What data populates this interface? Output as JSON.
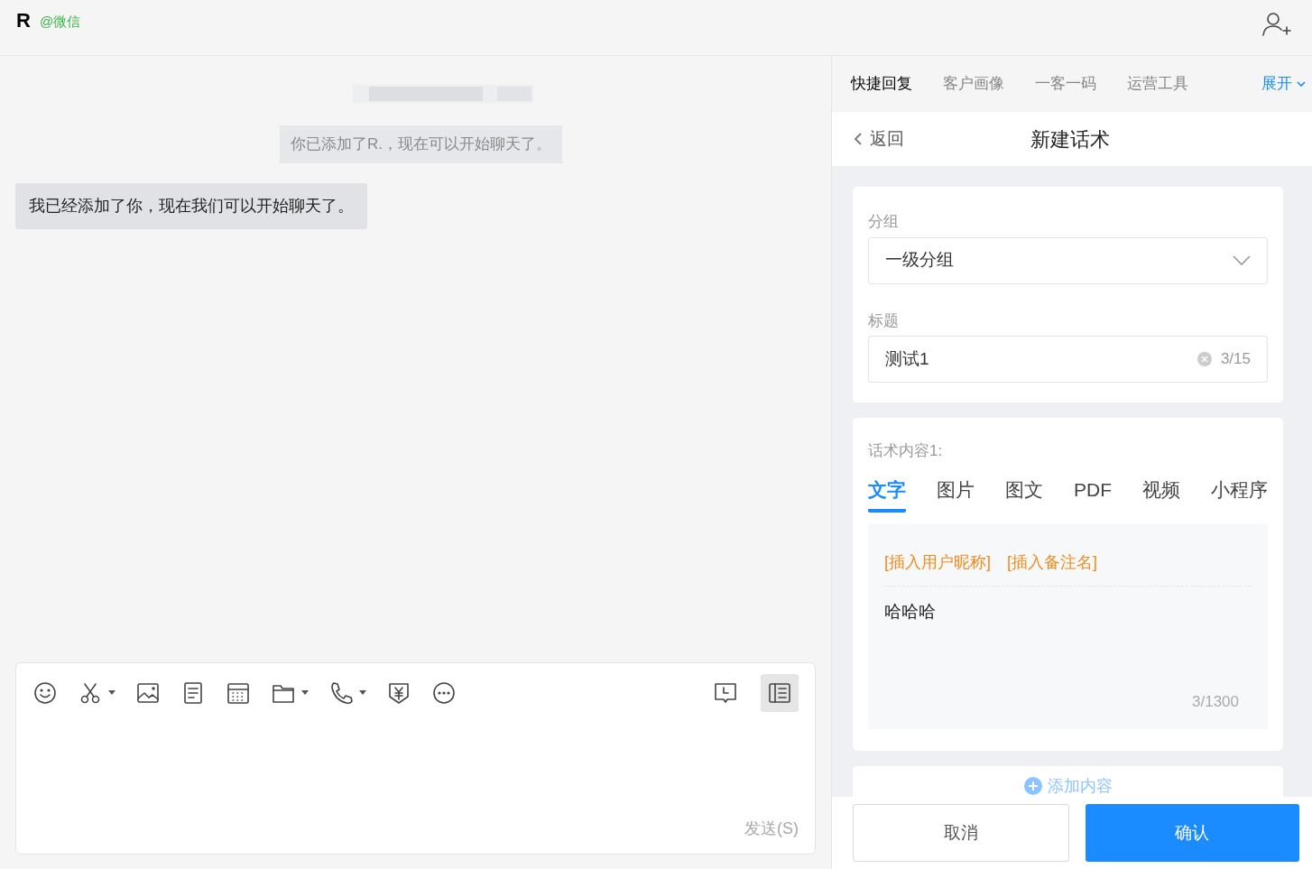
{
  "header": {
    "name": "R",
    "source": "@微信"
  },
  "chat": {
    "messages": [
      {
        "kind": "system",
        "text": "你已添加了R.，现在可以开始聊天了。"
      },
      {
        "kind": "incoming",
        "text": "我已经添加了你，现在我们可以开始聊天了。"
      }
    ],
    "composer": {
      "send_label": "发送(S)",
      "tools": [
        {
          "caret": false
        },
        {
          "caret": true
        },
        {
          "caret": false
        },
        {
          "caret": false
        },
        {
          "caret": false
        },
        {
          "caret": true
        },
        {
          "caret": true
        },
        {
          "caret": false
        },
        {
          "caret": false
        }
      ],
      "right_tools": [
        {
          "selected": false
        },
        {
          "selected": true
        }
      ]
    }
  },
  "side": {
    "tabs": [
      {
        "label": "快捷回复",
        "selected": true
      },
      {
        "label": "客户画像",
        "selected": false
      },
      {
        "label": "一客一码",
        "selected": false
      },
      {
        "label": "运营工具",
        "selected": false
      }
    ],
    "expand": "展开",
    "back": "返回",
    "title": "新建话术",
    "group_label": "分组",
    "group_value": "一级分组",
    "title_label": "标题",
    "title_value": "测试1",
    "title_count": "3/15",
    "content_label": "话术内容1:",
    "content_tabs": [
      {
        "label": "文字",
        "selected": true
      },
      {
        "label": "图片",
        "selected": false
      },
      {
        "label": "图文",
        "selected": false
      },
      {
        "label": "PDF",
        "selected": false
      },
      {
        "label": "视频",
        "selected": false
      },
      {
        "label": "小程序",
        "selected": false
      }
    ],
    "inserts": [
      "[插入用户昵称]",
      "[插入备注名]"
    ],
    "content_text": "哈哈哈",
    "content_count": "3/1300",
    "add_content": "添加内容",
    "cancel": "取消",
    "confirm": "确认"
  }
}
